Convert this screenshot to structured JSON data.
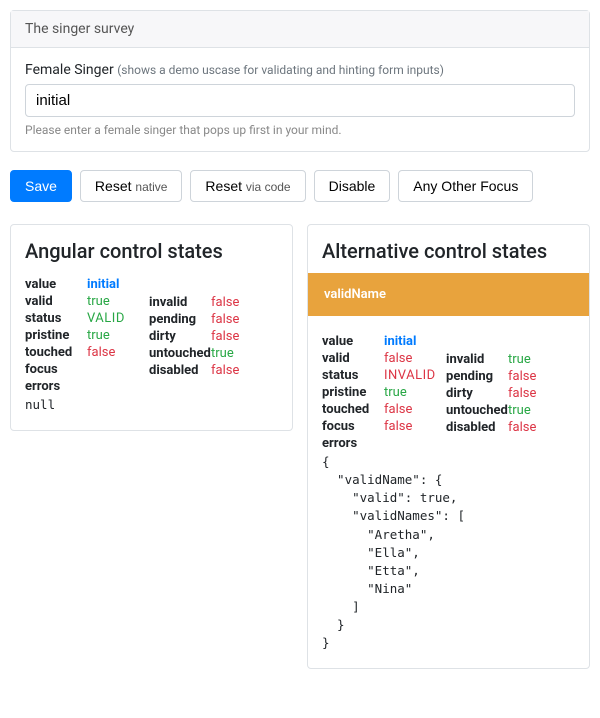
{
  "survey": {
    "card_title": "The singer survey",
    "label_main": "Female Singer",
    "label_sub": "(shows a demo uscase for validating and hinting form inputs)",
    "input_value": "initial",
    "hint": "Please enter a female singer that pops up first in your mind."
  },
  "buttons": {
    "save": "Save",
    "reset_main": "Reset",
    "reset_sub": "native",
    "reset2_main": "Reset",
    "reset2_sub": "via code",
    "disable": "Disable",
    "focus": "Any Other Focus"
  },
  "panels": {
    "angular_title": "Angular control states",
    "alternative_title": "Alternative control states",
    "alt_badge": "validName"
  },
  "angular": {
    "left": [
      {
        "k": "value",
        "v": "initial",
        "cls": "v-blue"
      },
      {
        "k": "valid",
        "v": "true",
        "cls": "v-green"
      },
      {
        "k": "status",
        "v": "VALID",
        "cls": "v-upgreen"
      },
      {
        "k": "pristine",
        "v": "true",
        "cls": "v-green"
      },
      {
        "k": "touched",
        "v": "false",
        "cls": "v-red"
      },
      {
        "k": "focus",
        "v": "",
        "cls": ""
      },
      {
        "k": "errors",
        "v": "",
        "cls": ""
      }
    ],
    "left_tail": "null",
    "right": [
      {
        "k": "invalid",
        "v": "false",
        "cls": "v-red"
      },
      {
        "k": "pending",
        "v": "false",
        "cls": "v-red"
      },
      {
        "k": "dirty",
        "v": "false",
        "cls": "v-red"
      },
      {
        "k": "untouched",
        "v": "true",
        "cls": "v-green"
      },
      {
        "k": "disabled",
        "v": "false",
        "cls": "v-red"
      }
    ]
  },
  "alternative": {
    "left": [
      {
        "k": "value",
        "v": "initial",
        "cls": "v-blue"
      },
      {
        "k": "valid",
        "v": "false",
        "cls": "v-red"
      },
      {
        "k": "status",
        "v": "INVALID",
        "cls": "v-upred"
      },
      {
        "k": "pristine",
        "v": "true",
        "cls": "v-green"
      },
      {
        "k": "touched",
        "v": "false",
        "cls": "v-red"
      },
      {
        "k": "focus",
        "v": "false",
        "cls": "v-red"
      },
      {
        "k": "errors",
        "v": "",
        "cls": ""
      }
    ],
    "right": [
      {
        "k": "invalid",
        "v": "true",
        "cls": "v-green"
      },
      {
        "k": "pending",
        "v": "false",
        "cls": "v-red"
      },
      {
        "k": "dirty",
        "v": "false",
        "cls": "v-red"
      },
      {
        "k": "untouched",
        "v": "true",
        "cls": "v-green"
      },
      {
        "k": "disabled",
        "v": "false",
        "cls": "v-red"
      }
    ],
    "errors_json": "{\n  \"validName\": {\n    \"valid\": true,\n    \"validNames\": [\n      \"Aretha\",\n      \"Ella\",\n      \"Etta\",\n      \"Nina\"\n    ]\n  }\n}"
  }
}
